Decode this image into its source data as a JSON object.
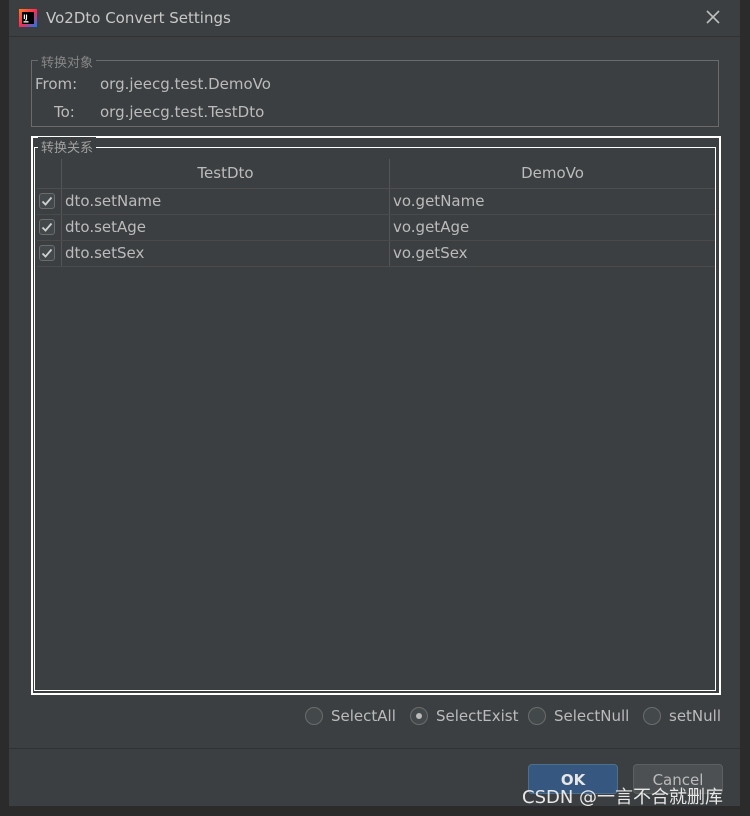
{
  "window": {
    "title": "Vo2Dto Convert Settings"
  },
  "target_group": {
    "legend": "转换对象",
    "from_label": "From:",
    "from_value": "org.jeecg.test.DemoVo",
    "to_label": "To:",
    "to_value": "org.jeecg.test.TestDto"
  },
  "mapping_group": {
    "legend": "转换关系",
    "columns": [
      "TestDto",
      "DemoVo"
    ],
    "rows": [
      {
        "checked": true,
        "dto": "dto.setName",
        "vo": "vo.getName"
      },
      {
        "checked": true,
        "dto": "dto.setAge",
        "vo": "vo.getAge"
      },
      {
        "checked": true,
        "dto": "dto.setSex",
        "vo": "vo.getSex"
      }
    ]
  },
  "radios": {
    "options": [
      "SelectAll",
      "SelectExist",
      "SelectNull",
      "setNull"
    ],
    "selected": "SelectExist"
  },
  "buttons": {
    "ok": "OK",
    "cancel": "Cancel"
  },
  "watermark": "CSDN @一言不合就删库",
  "colors": {
    "background": "#3c3f41",
    "primary_button": "#365880",
    "text": "#bbbbbb"
  }
}
